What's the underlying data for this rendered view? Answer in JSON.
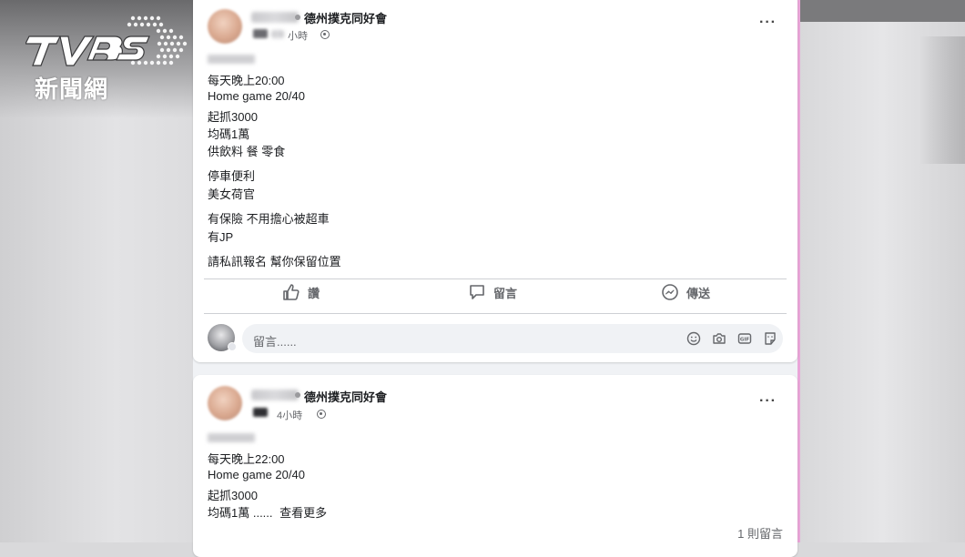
{
  "watermark": {
    "brand": "TVBS",
    "subtitle": "新聞網"
  },
  "posts": [
    {
      "group_name": "德州撲克同好會",
      "time": "小時",
      "more_label": "···",
      "body_lines": [
        "每天晚上20:00",
        "Home game 20/40",
        "起抓3000",
        "均碼1萬",
        "供飲料 餐 零食",
        "停車便利",
        "美女荷官",
        "有保險 不用擔心被超車",
        "有JP",
        "請私訊報名 幫你保留位置"
      ],
      "actions": {
        "like": "讚",
        "comment": "留言",
        "share": "傳送"
      },
      "comment_placeholder": "留言......",
      "comment_icons": [
        "emoji-icon",
        "camera-icon",
        "gif-icon",
        "sticker-icon"
      ]
    },
    {
      "group_name": "德州撲克同好會",
      "time": "4小時",
      "more_label": "···",
      "body_lines": [
        "每天晚上22:00",
        "Home game 20/40",
        "起抓3000",
        "均碼1萬 ......"
      ],
      "see_more": "查看更多",
      "comment_count": "1 則留言"
    }
  ]
}
